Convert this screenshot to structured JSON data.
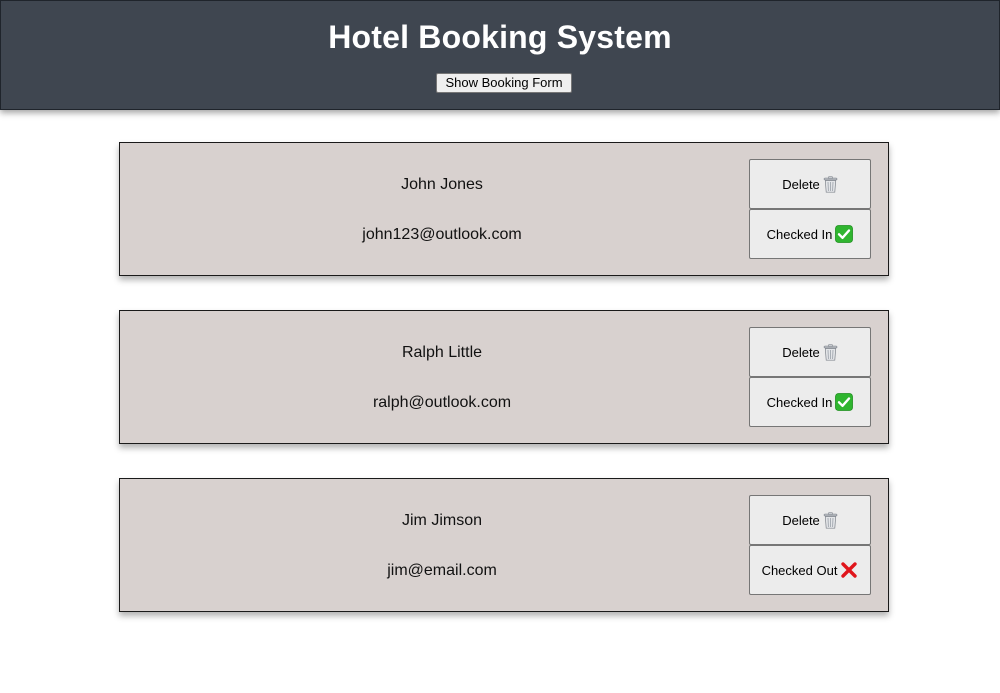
{
  "header": {
    "title": "Hotel Booking System",
    "form_button_label": "Show Booking Form",
    "background_color": "#3f4650"
  },
  "bookings": [
    {
      "name": "John Jones",
      "email": "john123@outlook.com",
      "delete_label": "Delete",
      "status_label": "Checked In",
      "status_icon": "check-mark-icon"
    },
    {
      "name": "Ralph Little",
      "email": "ralph@outlook.com",
      "delete_label": "Delete",
      "status_label": "Checked In",
      "status_icon": "check-mark-icon"
    },
    {
      "name": "Jim Jimson",
      "email": "jim@email.com",
      "delete_label": "Delete",
      "status_label": "Checked Out",
      "status_icon": "cross-mark-icon"
    }
  ],
  "colors": {
    "card_background": "#d8d1cf",
    "check_green": "#2fb52f",
    "cross_red": "#e0151b"
  }
}
